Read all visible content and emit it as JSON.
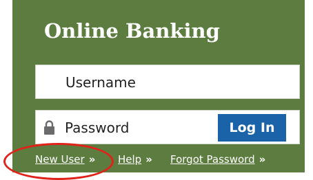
{
  "panel": {
    "title": "Online Banking",
    "background_color": "#5c7d3f"
  },
  "username": {
    "placeholder": "Username"
  },
  "password": {
    "placeholder": "Password",
    "icon": "lock-icon"
  },
  "login_button": {
    "label": "Log In",
    "color": "#1a63a8"
  },
  "links": {
    "new_user": "New User",
    "help": "Help",
    "forgot_password": "Forgot Password",
    "chevron": "»"
  },
  "annotation": {
    "color": "#e0221b",
    "target": "new-user-link"
  }
}
